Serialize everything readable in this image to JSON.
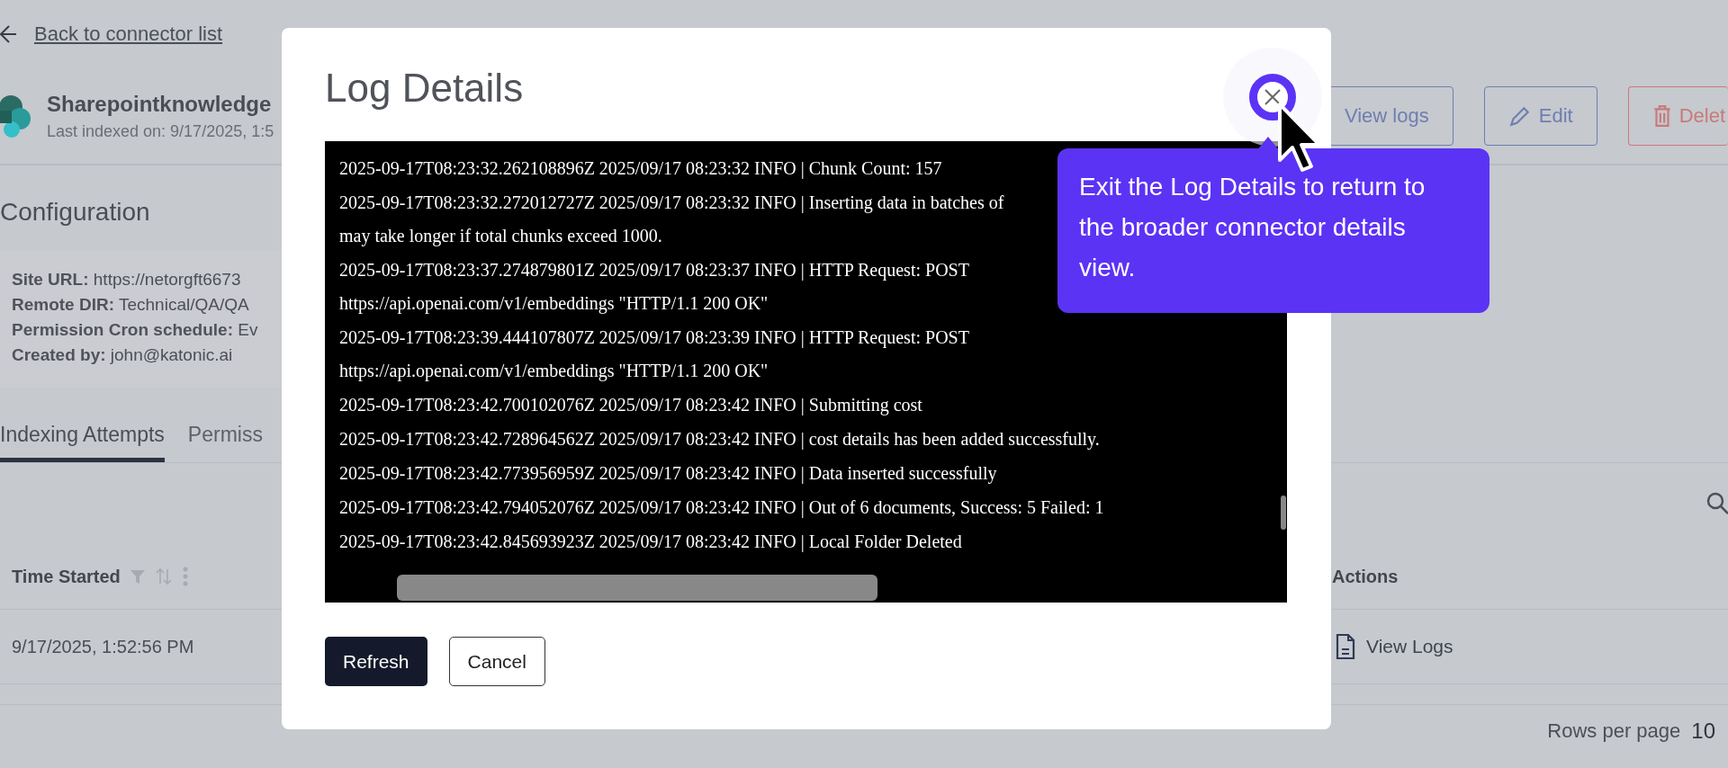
{
  "back_link": "Back to connector list",
  "connector": {
    "name": "Sharepointknowledge",
    "last_indexed": "Last indexed on: 9/17/2025, 1:5"
  },
  "header_buttons": [
    {
      "label": "View logs",
      "kind": "outline"
    },
    {
      "label": "Edit",
      "kind": "edit"
    },
    {
      "label": "Delet",
      "kind": "danger"
    }
  ],
  "configuration": {
    "title": "Configuration",
    "fields": [
      {
        "label": "Site URL:",
        "value": "https://netorgft6673"
      },
      {
        "label": "Remote DIR:",
        "value": "Technical/QA/QA"
      },
      {
        "label": "Permission Cron schedule:",
        "value": "Ev"
      },
      {
        "label": "Created by:",
        "value": "john@katonic.ai"
      }
    ]
  },
  "tabs": [
    {
      "label": "Indexing Attempts",
      "selected": true
    },
    {
      "label": "Permiss",
      "selected": false
    }
  ],
  "table": {
    "columns": [
      "Time Started",
      "Actions"
    ],
    "rows": [
      {
        "time_started": "9/17/2025, 1:52:56 PM",
        "action": "View Logs"
      }
    ]
  },
  "pagination": {
    "label": "Rows per page",
    "value": "10"
  },
  "modal": {
    "title": "Log Details",
    "log": [
      [
        "2025-09-17T08:23:32.262108896Z 2025/09/17 08:23:32 INFO | Chunk Count: 157"
      ],
      [
        "2025-09-17T08:23:32.272012727Z 2025/09/17 08:23:32 INFO | Inserting data in batches of",
        "may take longer if total chunks exceed 1000."
      ],
      [
        "2025-09-17T08:23:37.274879801Z 2025/09/17 08:23:37 INFO | HTTP Request: POST",
        "https://api.openai.com/v1/embeddings \"HTTP/1.1 200 OK\""
      ],
      [
        "2025-09-17T08:23:39.444107807Z 2025/09/17 08:23:39 INFO | HTTP Request: POST",
        "https://api.openai.com/v1/embeddings \"HTTP/1.1 200 OK\""
      ],
      [
        "2025-09-17T08:23:42.700102076Z 2025/09/17 08:23:42 INFO | Submitting cost"
      ],
      [
        "2025-09-17T08:23:42.728964562Z 2025/09/17 08:23:42 INFO | cost details has been added successfully."
      ],
      [
        "2025-09-17T08:23:42.773956959Z 2025/09/17 08:23:42 INFO | Data inserted successfully"
      ],
      [
        "2025-09-17T08:23:42.794052076Z 2025/09/17 08:23:42 INFO | Out of 6 documents, Success: 5 Failed: 1"
      ],
      [
        "2025-09-17T08:23:42.845693923Z 2025/09/17 08:23:42 INFO | Local Folder Deleted"
      ]
    ],
    "buttons": [
      {
        "label": "Refresh",
        "kind": "primary"
      },
      {
        "label": "Cancel",
        "kind": "secondary"
      }
    ]
  },
  "tooltip": {
    "text": "Exit the Log Details to return to the broader connector details view."
  }
}
